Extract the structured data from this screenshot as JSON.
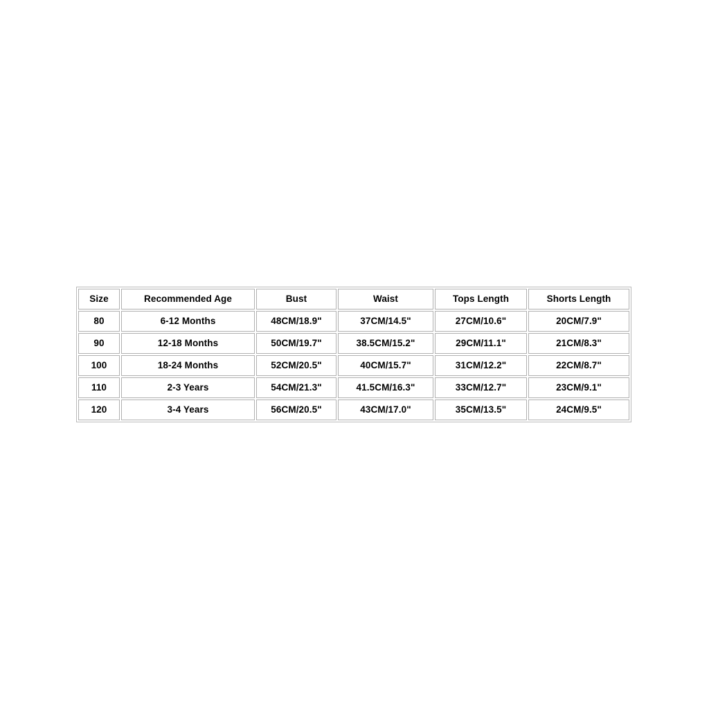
{
  "page": {
    "background_color": "#ffffff",
    "text_color": "#000000",
    "border_color": "#b0b0b0",
    "outer_border_color": "#b9b9b9"
  },
  "size_chart": {
    "columns": [
      "Size",
      "Recommended Age",
      "Bust",
      "Waist",
      "Tops Length",
      "Shorts Length"
    ],
    "rows": [
      {
        "size": "80",
        "age": "6-12 Months",
        "bust": "48CM/18.9\"",
        "waist": "37CM/14.5\"",
        "tops_length": "27CM/10.6\"",
        "shorts_length": "20CM/7.9\""
      },
      {
        "size": "90",
        "age": "12-18 Months",
        "bust": "50CM/19.7\"",
        "waist": "38.5CM/15.2\"",
        "tops_length": "29CM/11.1\"",
        "shorts_length": "21CM/8.3\""
      },
      {
        "size": "100",
        "age": "18-24 Months",
        "bust": "52CM/20.5\"",
        "waist": "40CM/15.7\"",
        "tops_length": "31CM/12.2\"",
        "shorts_length": "22CM/8.7\""
      },
      {
        "size": "110",
        "age": "2-3 Years",
        "bust": "54CM/21.3\"",
        "waist": "41.5CM/16.3\"",
        "tops_length": "33CM/12.7\"",
        "shorts_length": "23CM/9.1\""
      },
      {
        "size": "120",
        "age": "3-4 Years",
        "bust": "56CM/20.5\"",
        "waist": "43CM/17.0\"",
        "tops_length": "35CM/13.5\"",
        "shorts_length": "24CM/9.5\""
      }
    ]
  }
}
